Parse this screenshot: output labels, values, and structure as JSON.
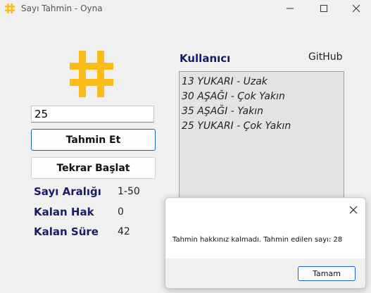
{
  "window": {
    "title": "Sayı Tahmin - Oyna"
  },
  "input": {
    "value": "25"
  },
  "buttons": {
    "guess": "Tahmin Et",
    "restart": "Tekrar Başlat"
  },
  "stats": [
    {
      "label": "Sayı Aralığı",
      "value": "1-50"
    },
    {
      "label": "Kalan Hak",
      "value": "0"
    },
    {
      "label": "Kalan Süre",
      "value": "42"
    }
  ],
  "user_label": "Kullanıcı",
  "github_label": "GitHub",
  "history": [
    "13 YUKARI - Uzak",
    "30 AŞAĞI - Çok Yakın",
    "35 AŞAĞI - Yakın",
    "25 YUKARI - Çok Yakın"
  ],
  "dialog": {
    "message": "Tahmin hakkınız kalmadı. Tahmin edilen sayı: 28",
    "ok": "Tamam"
  },
  "colors": {
    "accent": "#fbbc18",
    "label": "#1b1b6b",
    "focus": "#1565c0"
  }
}
